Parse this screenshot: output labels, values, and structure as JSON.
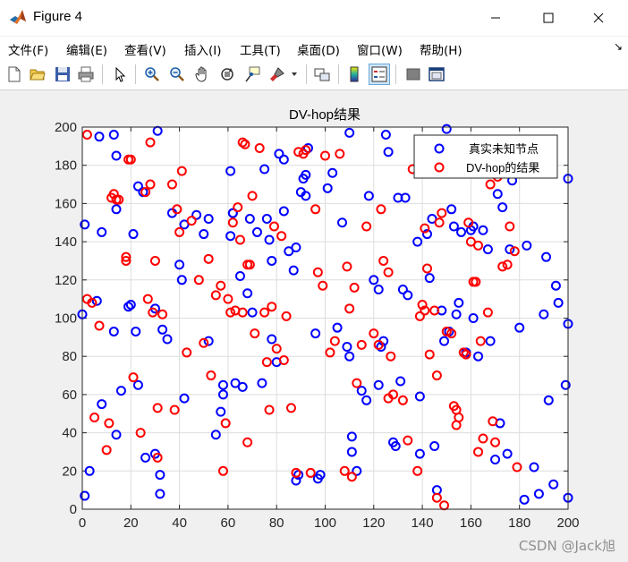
{
  "window": {
    "title": "Figure 4",
    "controls": [
      "minimize",
      "maximize",
      "close"
    ]
  },
  "menu": {
    "items": [
      "文件(F)",
      "编辑(E)",
      "查看(V)",
      "插入(I)",
      "工具(T)",
      "桌面(D)",
      "窗口(W)",
      "帮助(H)"
    ],
    "overflow_glyph": "↘"
  },
  "toolbar": {
    "buttons": [
      "new-figure-icon",
      "open-icon",
      "save-icon",
      "print-icon",
      "pointer-icon",
      "zoom-in-icon",
      "zoom-out-icon",
      "pan-icon",
      "rotate-icon",
      "data-cursor-icon",
      "brush-icon",
      "link-plot-icon",
      "colorbar-icon",
      "legend-icon",
      "hide-plot-tools-icon",
      "show-plot-tools-icon"
    ],
    "pressed": "legend-icon"
  },
  "watermark": "CSDN @Jack旭",
  "colors": {
    "series1": "#0000ff",
    "series2": "#ff0000",
    "grid": "#dddddd"
  },
  "chart_data": {
    "type": "scatter",
    "title": "DV-hop结果",
    "xlim": [
      0,
      200
    ],
    "ylim": [
      0,
      200
    ],
    "xticks": [
      0,
      20,
      40,
      60,
      80,
      100,
      120,
      140,
      160,
      180,
      200
    ],
    "yticks": [
      0,
      20,
      40,
      60,
      80,
      100,
      120,
      140,
      160,
      180,
      200
    ],
    "grid": true,
    "marker": "circle-open",
    "legend_position": "top-right",
    "series": [
      {
        "name": "真实未知节点",
        "color": "#0000ff",
        "points": [
          [
            0,
            102
          ],
          [
            1,
            149
          ],
          [
            1,
            7
          ],
          [
            3,
            20
          ],
          [
            6,
            109
          ],
          [
            7,
            195
          ],
          [
            8,
            145
          ],
          [
            8,
            55
          ],
          [
            13,
            196
          ],
          [
            14,
            185
          ],
          [
            14,
            157
          ],
          [
            13,
            93
          ],
          [
            14,
            39
          ],
          [
            16,
            62
          ],
          [
            19,
            106
          ],
          [
            20,
            107
          ],
          [
            21,
            144
          ],
          [
            22,
            93
          ],
          [
            23,
            65
          ],
          [
            23,
            169
          ],
          [
            25,
            166
          ],
          [
            26,
            27
          ],
          [
            30,
            29
          ],
          [
            30,
            105
          ],
          [
            31,
            198
          ],
          [
            32,
            8
          ],
          [
            33,
            94
          ],
          [
            32,
            18
          ],
          [
            35,
            89
          ],
          [
            37,
            155
          ],
          [
            40,
            128
          ],
          [
            41,
            120
          ],
          [
            42,
            149
          ],
          [
            42,
            58
          ],
          [
            47,
            154
          ],
          [
            50,
            144
          ],
          [
            52,
            152
          ],
          [
            52,
            88
          ],
          [
            55,
            39
          ],
          [
            57,
            51
          ],
          [
            58,
            60
          ],
          [
            58,
            65
          ],
          [
            61,
            177
          ],
          [
            62,
            155
          ],
          [
            63,
            66
          ],
          [
            61,
            143
          ],
          [
            62,
            155
          ],
          [
            65,
            122
          ],
          [
            66,
            64
          ],
          [
            68,
            113
          ],
          [
            69,
            152
          ],
          [
            70,
            103
          ],
          [
            72,
            145
          ],
          [
            75,
            178
          ],
          [
            74,
            66
          ],
          [
            76,
            152
          ],
          [
            77,
            141
          ],
          [
            78,
            130
          ],
          [
            78,
            89
          ],
          [
            80,
            77
          ],
          [
            81,
            186
          ],
          [
            83,
            183
          ],
          [
            83,
            156
          ],
          [
            85,
            135
          ],
          [
            87,
            125
          ],
          [
            88,
            137
          ],
          [
            88,
            15
          ],
          [
            89,
            18
          ],
          [
            90,
            166
          ],
          [
            91,
            173
          ],
          [
            92,
            164
          ],
          [
            92,
            175
          ],
          [
            93,
            189
          ],
          [
            96,
            92
          ],
          [
            97,
            16
          ],
          [
            98,
            18
          ],
          [
            101,
            168
          ],
          [
            103,
            176
          ],
          [
            105,
            95
          ],
          [
            107,
            150
          ],
          [
            109,
            85
          ],
          [
            110,
            197
          ],
          [
            110,
            80
          ],
          [
            111,
            38
          ],
          [
            111,
            30
          ],
          [
            113,
            20
          ],
          [
            115,
            62
          ],
          [
            117,
            57
          ],
          [
            118,
            164
          ],
          [
            120,
            120
          ],
          [
            122,
            115
          ],
          [
            122,
            65
          ],
          [
            123,
            85
          ],
          [
            124,
            88
          ],
          [
            125,
            196
          ],
          [
            126,
            187
          ],
          [
            128,
            35
          ],
          [
            129,
            33
          ],
          [
            130,
            163
          ],
          [
            131,
            67
          ],
          [
            132,
            115
          ],
          [
            133,
            163
          ],
          [
            134,
            112
          ],
          [
            138,
            140
          ],
          [
            139,
            59
          ],
          [
            139,
            29
          ],
          [
            142,
            144
          ],
          [
            143,
            121
          ],
          [
            144,
            152
          ],
          [
            145,
            33
          ],
          [
            146,
            10
          ],
          [
            148,
            104
          ],
          [
            149,
            88
          ],
          [
            150,
            199
          ],
          [
            151,
            93
          ],
          [
            152,
            157
          ],
          [
            153,
            148
          ],
          [
            154,
            102
          ],
          [
            155,
            108
          ],
          [
            156,
            145
          ],
          [
            158,
            82
          ],
          [
            160,
            146
          ],
          [
            161,
            100
          ],
          [
            161,
            148
          ],
          [
            163,
            80
          ],
          [
            165,
            146
          ],
          [
            166,
            183
          ],
          [
            167,
            136
          ],
          [
            168,
            88
          ],
          [
            170,
            26
          ],
          [
            171,
            165
          ],
          [
            172,
            45
          ],
          [
            173,
            158
          ],
          [
            175,
            29
          ],
          [
            176,
            136
          ],
          [
            177,
            172
          ],
          [
            180,
            95
          ],
          [
            182,
            5
          ],
          [
            183,
            138
          ],
          [
            186,
            22
          ],
          [
            188,
            8
          ],
          [
            190,
            102
          ],
          [
            191,
            132
          ],
          [
            192,
            57
          ],
          [
            194,
            13
          ],
          [
            195,
            117
          ],
          [
            196,
            108
          ],
          [
            199,
            65
          ],
          [
            200,
            173
          ],
          [
            200,
            97
          ],
          [
            200,
            6
          ]
        ]
      },
      {
        "name": "DV-hop的结果",
        "color": "#ff0000",
        "points": [
          [
            2,
            196
          ],
          [
            2,
            110
          ],
          [
            4,
            108
          ],
          [
            5,
            48
          ],
          [
            7,
            96
          ],
          [
            10,
            31
          ],
          [
            11,
            45
          ],
          [
            12,
            163
          ],
          [
            13,
            165
          ],
          [
            14,
            162
          ],
          [
            15,
            162
          ],
          [
            18,
            132
          ],
          [
            18,
            130
          ],
          [
            19,
            183
          ],
          [
            20,
            183
          ],
          [
            21,
            69
          ],
          [
            24,
            40
          ],
          [
            26,
            166
          ],
          [
            27,
            110
          ],
          [
            28,
            192
          ],
          [
            28,
            170
          ],
          [
            29,
            103
          ],
          [
            30,
            130
          ],
          [
            31,
            53
          ],
          [
            31,
            27
          ],
          [
            33,
            102
          ],
          [
            37,
            170
          ],
          [
            38,
            52
          ],
          [
            39,
            157
          ],
          [
            40,
            145
          ],
          [
            41,
            177
          ],
          [
            43,
            82
          ],
          [
            45,
            151
          ],
          [
            48,
            120
          ],
          [
            50,
            87
          ],
          [
            52,
            131
          ],
          [
            53,
            70
          ],
          [
            55,
            112
          ],
          [
            57,
            117
          ],
          [
            58,
            20
          ],
          [
            59,
            45
          ],
          [
            60,
            110
          ],
          [
            61,
            103
          ],
          [
            62,
            150
          ],
          [
            63,
            104
          ],
          [
            64,
            158
          ],
          [
            65,
            141
          ],
          [
            66,
            192
          ],
          [
            66,
            103
          ],
          [
            67,
            191
          ],
          [
            68,
            128
          ],
          [
            68,
            35
          ],
          [
            69,
            128
          ],
          [
            70,
            164
          ],
          [
            71,
            92
          ],
          [
            73,
            189
          ],
          [
            75,
            103
          ],
          [
            76,
            77
          ],
          [
            77,
            52
          ],
          [
            78,
            106
          ],
          [
            79,
            148
          ],
          [
            80,
            84
          ],
          [
            82,
            143
          ],
          [
            83,
            78
          ],
          [
            84,
            101
          ],
          [
            86,
            53
          ],
          [
            88,
            19
          ],
          [
            89,
            187
          ],
          [
            91,
            186
          ],
          [
            92,
            188
          ],
          [
            94,
            19
          ],
          [
            96,
            157
          ],
          [
            97,
            124
          ],
          [
            99,
            117
          ],
          [
            100,
            185
          ],
          [
            102,
            82
          ],
          [
            104,
            88
          ],
          [
            106,
            186
          ],
          [
            108,
            20
          ],
          [
            109,
            127
          ],
          [
            110,
            105
          ],
          [
            111,
            17
          ],
          [
            112,
            116
          ],
          [
            113,
            66
          ],
          [
            115,
            86
          ],
          [
            117,
            148
          ],
          [
            120,
            92
          ],
          [
            122,
            86
          ],
          [
            123,
            157
          ],
          [
            124,
            130
          ],
          [
            126,
            124
          ],
          [
            126,
            58
          ],
          [
            127,
            80
          ],
          [
            128,
            60
          ],
          [
            132,
            57
          ],
          [
            134,
            36
          ],
          [
            136,
            178
          ],
          [
            138,
            20
          ],
          [
            139,
            101
          ],
          [
            140,
            107
          ],
          [
            141,
            147
          ],
          [
            141,
            104
          ],
          [
            142,
            126
          ],
          [
            143,
            81
          ],
          [
            145,
            104
          ],
          [
            146,
            70
          ],
          [
            146,
            6
          ],
          [
            147,
            150
          ],
          [
            148,
            155
          ],
          [
            149,
            2
          ],
          [
            150,
            93
          ],
          [
            151,
            182
          ],
          [
            152,
            92
          ],
          [
            153,
            54
          ],
          [
            154,
            52
          ],
          [
            154,
            44
          ],
          [
            155,
            48
          ],
          [
            157,
            82
          ],
          [
            158,
            81
          ],
          [
            159,
            150
          ],
          [
            160,
            140
          ],
          [
            161,
            119
          ],
          [
            162,
            119
          ],
          [
            163,
            30
          ],
          [
            163,
            138
          ],
          [
            164,
            88
          ],
          [
            165,
            37
          ],
          [
            167,
            103
          ],
          [
            168,
            170
          ],
          [
            169,
            46
          ],
          [
            170,
            35
          ],
          [
            171,
            174
          ],
          [
            173,
            127
          ],
          [
            175,
            128
          ],
          [
            176,
            148
          ],
          [
            178,
            135
          ],
          [
            179,
            22
          ]
        ]
      }
    ]
  }
}
